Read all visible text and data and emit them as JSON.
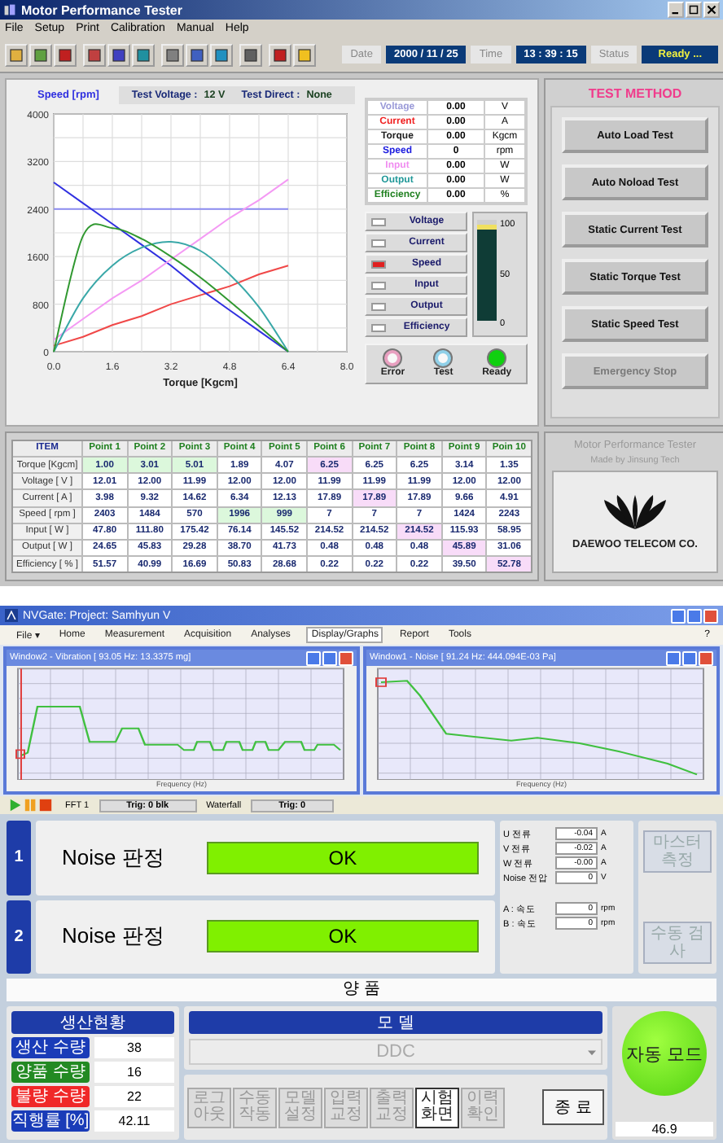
{
  "tester": {
    "title": "Motor Performance Tester",
    "menu": [
      "File",
      "Setup",
      "Print",
      "Calibration",
      "Manual",
      "Help"
    ],
    "date": {
      "label": "Date",
      "value": "2000 / 11 / 25"
    },
    "time": {
      "label": "Time",
      "value": "13 : 39 : 15"
    },
    "status": {
      "label": "Status",
      "value": "Ready ..."
    },
    "test_voltage": {
      "label": "Test Voltage :",
      "value": "12 V"
    },
    "test_direct": {
      "label": "Test Direct :",
      "value": "None"
    },
    "chart_data": {
      "type": "line",
      "grid": true,
      "xlabel": "Torque [Kgcm]",
      "ylabel": "Speed [rpm]",
      "x": [
        0,
        0.8,
        1.6,
        2.4,
        3.2,
        4.0,
        4.8,
        5.6,
        6.4
      ],
      "xlim": [
        0,
        8
      ],
      "ylim": [
        0,
        4000
      ],
      "xticks": [
        {
          "value": 0,
          "label": "0.0"
        },
        {
          "value": 1.6,
          "label": "1.6"
        },
        {
          "value": 3.2,
          "label": "3.2"
        },
        {
          "value": 4.8,
          "label": "4.8"
        },
        {
          "value": 6.4,
          "label": "6.4"
        },
        {
          "value": 8,
          "label": "8.0"
        }
      ],
      "yticks": [
        0,
        800,
        1600,
        2400,
        3200,
        4000
      ],
      "series": [
        {
          "name": "Voltage",
          "color": "#8c8cf0",
          "values": [
            2400,
            2400,
            2400,
            2400,
            2400,
            2400,
            2400,
            2400,
            2400
          ]
        },
        {
          "name": "Current",
          "color": "#f04848",
          "values": [
            100,
            250,
            450,
            600,
            800,
            950,
            1100,
            1300,
            1450
          ]
        },
        {
          "name": "Speed",
          "color": "#3030e0",
          "values": [
            2850,
            2500,
            2150,
            1800,
            1450,
            1050,
            700,
            350,
            0
          ]
        },
        {
          "name": "Input",
          "color": "#f49af4",
          "values": [
            200,
            550,
            900,
            1200,
            1550,
            1900,
            2250,
            2550,
            2900
          ]
        },
        {
          "name": "Output",
          "color": "#3aa8a8",
          "values": [
            0,
            900,
            1450,
            1750,
            1850,
            1700,
            1300,
            750,
            0
          ]
        },
        {
          "name": "Efficiency",
          "color": "#309830",
          "values": [
            0,
            1950,
            2080,
            1900,
            1600,
            1250,
            850,
            430,
            0
          ]
        }
      ]
    },
    "readings": [
      {
        "name": "Voltage",
        "value": "0.00",
        "unit": "V",
        "color": "#9a9ad8"
      },
      {
        "name": "Current",
        "value": "0.00",
        "unit": "A",
        "color": "#f02020"
      },
      {
        "name": "Torque",
        "value": "0.00",
        "unit": "Kgcm",
        "color": "#202020"
      },
      {
        "name": "Speed",
        "value": "0",
        "unit": "rpm",
        "color": "#2020e0"
      },
      {
        "name": "Input",
        "value": "0.00",
        "unit": "W",
        "color": "#f08cf0"
      },
      {
        "name": "Output",
        "value": "0.00",
        "unit": "W",
        "color": "#209898"
      },
      {
        "name": "Efficiency",
        "value": "0.00",
        "unit": "%",
        "color": "#208020"
      }
    ],
    "legend": [
      {
        "checked": false
      },
      {
        "checked": false
      },
      {
        "checked": true
      },
      {
        "checked": false
      },
      {
        "checked": false
      },
      {
        "checked": false
      }
    ],
    "gauge": {
      "level": 0.95,
      "ticks": [
        "100",
        "50",
        "0"
      ]
    },
    "lamps": [
      {
        "label": "Error",
        "on": false,
        "color": "#e8a0c0"
      },
      {
        "label": "Test",
        "on": false,
        "color": "#90d0e8"
      },
      {
        "label": "Ready",
        "on": true,
        "color": "#10d010"
      }
    ],
    "test_method": {
      "title": "TEST METHOD",
      "buttons": [
        {
          "label": "Auto Load Test",
          "disabled": false
        },
        {
          "label": "Auto Noload Test",
          "disabled": false
        },
        {
          "label": "Static Current Test",
          "disabled": false
        },
        {
          "label": "Static Torque Test",
          "disabled": false
        },
        {
          "label": "Static Speed Test",
          "disabled": false
        },
        {
          "label": "Emergency Stop",
          "disabled": true
        }
      ]
    },
    "points_table": {
      "columns": [
        "ITEM",
        "Point 1",
        "Point 2",
        "Point 3",
        "Point 4",
        "Point 5",
        "Point 6",
        "Point 7",
        "Point 8",
        "Point 9",
        "Poin 10"
      ],
      "rows": [
        {
          "cells": [
            {
              "value": "Torque [Kgcm]"
            },
            {
              "value": "1.00",
              "color": "#dcf8dc"
            },
            {
              "value": "3.01",
              "color": "#dcf8dc"
            },
            {
              "value": "5.01",
              "color": "#dcf8dc"
            },
            {
              "value": "1.89"
            },
            {
              "value": "4.07"
            },
            {
              "value": "6.25",
              "color": "#f8dcf8"
            },
            {
              "value": "6.25"
            },
            {
              "value": "6.25"
            },
            {
              "value": "3.14"
            },
            {
              "value": "1.35"
            }
          ]
        },
        {
          "cells": [
            {
              "value": "Voltage [ V ]"
            },
            {
              "value": "12.01"
            },
            {
              "value": "12.00"
            },
            {
              "value": "11.99"
            },
            {
              "value": "12.00"
            },
            {
              "value": "12.00"
            },
            {
              "value": "11.99"
            },
            {
              "value": "11.99"
            },
            {
              "value": "11.99"
            },
            {
              "value": "12.00"
            },
            {
              "value": "12.00"
            }
          ]
        },
        {
          "cells": [
            {
              "value": "Current [ A ]"
            },
            {
              "value": "3.98"
            },
            {
              "value": "9.32"
            },
            {
              "value": "14.62"
            },
            {
              "value": "6.34"
            },
            {
              "value": "12.13"
            },
            {
              "value": "17.89"
            },
            {
              "value": "17.89",
              "color": "#f8dcf8"
            },
            {
              "value": "17.89"
            },
            {
              "value": "9.66"
            },
            {
              "value": "4.91"
            }
          ]
        },
        {
          "cells": [
            {
              "value": "Speed [ rpm ]"
            },
            {
              "value": "2403"
            },
            {
              "value": "1484"
            },
            {
              "value": "570"
            },
            {
              "value": "1996",
              "color": "#dcf8dc"
            },
            {
              "value": "999",
              "color": "#dcf8dc"
            },
            {
              "value": "7"
            },
            {
              "value": "7"
            },
            {
              "value": "7"
            },
            {
              "value": "1424"
            },
            {
              "value": "2243"
            }
          ]
        },
        {
          "cells": [
            {
              "value": "Input [ W ]"
            },
            {
              "value": "47.80"
            },
            {
              "value": "111.80"
            },
            {
              "value": "175.42"
            },
            {
              "value": "76.14"
            },
            {
              "value": "145.52"
            },
            {
              "value": "214.52"
            },
            {
              "value": "214.52"
            },
            {
              "value": "214.52",
              "color": "#f8dcf8"
            },
            {
              "value": "115.93"
            },
            {
              "value": "58.95"
            }
          ]
        },
        {
          "cells": [
            {
              "value": "Output [ W ]"
            },
            {
              "value": "24.65"
            },
            {
              "value": "45.83"
            },
            {
              "value": "29.28"
            },
            {
              "value": "38.70"
            },
            {
              "value": "41.73"
            },
            {
              "value": "0.48"
            },
            {
              "value": "0.48"
            },
            {
              "value": "0.48"
            },
            {
              "value": "45.89",
              "color": "#f8dcf8"
            },
            {
              "value": "31.06"
            }
          ]
        },
        {
          "cells": [
            {
              "value": "Efficiency [ % ]"
            },
            {
              "value": "51.57"
            },
            {
              "value": "40.99"
            },
            {
              "value": "16.69"
            },
            {
              "value": "50.83"
            },
            {
              "value": "28.68"
            },
            {
              "value": "0.22"
            },
            {
              "value": "0.22"
            },
            {
              "value": "0.22"
            },
            {
              "value": "39.50"
            },
            {
              "value": "52.78",
              "color": "#f8dcf8"
            }
          ]
        }
      ]
    },
    "brand": {
      "title": "Motor Performance Tester",
      "subtitle": "Made by Jinsung Tech",
      "company": "DAEWOO TELECOM CO."
    }
  },
  "nvgate": {
    "title": "NVGate: Project: Samhyun V",
    "file_menu": "File ▾",
    "menu": [
      {
        "label": "Home",
        "selected": false
      },
      {
        "label": "Measurement",
        "selected": false
      },
      {
        "label": "Acquisition",
        "selected": false
      },
      {
        "label": "Analyses",
        "selected": false
      },
      {
        "label": "Display/Graphs",
        "selected": true
      },
      {
        "label": "Report",
        "selected": false
      },
      {
        "label": "Tools",
        "selected": false
      }
    ],
    "help": "?",
    "windows": [
      {
        "kind": "vibration",
        "title": "Window2 - Vibration [ 93.05 Hz: 13.3375 mg]",
        "xlabel": "Frequency (Hz)"
      },
      {
        "kind": "noise",
        "title": "Window1 - Noise [ 91.24 Hz: 444.094E-03 Pa]",
        "xlabel": "Frequency (Hz)"
      }
    ],
    "status": {
      "analyzer": "FFT 1",
      "analyzer_trig": "Trig: 0 blk",
      "waterfall": "Waterfall",
      "waterfall_trig": "Trig: 0"
    }
  },
  "station": {
    "lines": [
      {
        "number": "1",
        "label": "Noise 판정",
        "result": "OK"
      },
      {
        "number": "2",
        "label": "Noise 판정",
        "result": "OK"
      }
    ],
    "measurements": [
      {
        "label": "U 전류",
        "value": "-0.04",
        "unit": "A"
      },
      {
        "label": "V 전류",
        "value": "-0.02",
        "unit": "A"
      },
      {
        "label": "W 전류",
        "value": "-0.00",
        "unit": "A"
      },
      {
        "label": "Noise 전압",
        "value": "0",
        "unit": "V"
      },
      {
        "label": "A : 속도",
        "value": "0",
        "unit": "rpm"
      },
      {
        "label": "B : 속도",
        "value": "0",
        "unit": "rpm"
      }
    ],
    "side_buttons": [
      "마스터 측정",
      "수동 검사"
    ],
    "verdict": "양 품",
    "production": {
      "title": "생산현황",
      "rows": [
        {
          "label": "생산 수량",
          "value": "38",
          "color": "#1a3cb8"
        },
        {
          "label": "양품 수량",
          "value": "16",
          "color": "#238a23"
        },
        {
          "label": "불량 수량",
          "value": "22",
          "color": "#f02828"
        },
        {
          "label": "직행률 [%]",
          "value": "42.11",
          "color": "#1a3cb8"
        }
      ]
    },
    "model": {
      "title": "모 델",
      "value": "DDC",
      "buttons": [
        {
          "label": "로그아웃",
          "selected": false
        },
        {
          "label": "수동 작동",
          "selected": false
        },
        {
          "label": "모델 설정",
          "selected": false
        },
        {
          "label": "입력 교정",
          "selected": false
        },
        {
          "label": "출력 교정",
          "selected": false
        },
        {
          "label": "시험 화면",
          "selected": true
        },
        {
          "label": "이력 확인",
          "selected": false
        }
      ],
      "exit": "종 료"
    },
    "mode": "자동 모드",
    "reading": "46.9"
  }
}
